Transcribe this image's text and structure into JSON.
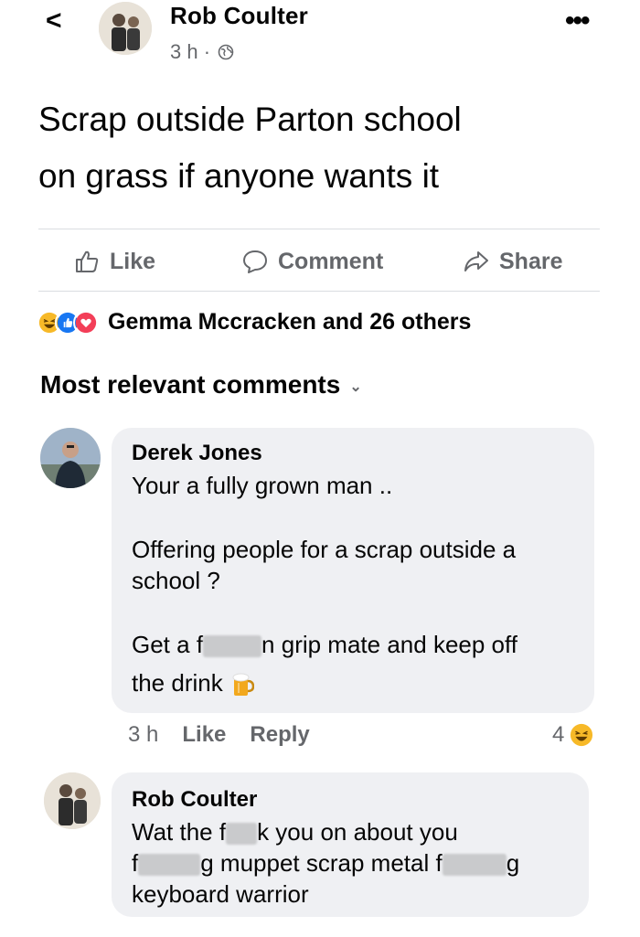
{
  "post": {
    "author": "Rob Coulter",
    "time": "3 h ·",
    "text_line1": "Scrap outside Parton school",
    "text_line2": "on grass if anyone wants it"
  },
  "actions": {
    "like": "Like",
    "comment": "Comment",
    "share": "Share"
  },
  "reactions": {
    "summary": "Gemma Mccracken and 26 others"
  },
  "comments_header": "Most relevant comments",
  "comments": [
    {
      "author": "Derek Jones",
      "line1": "Your a fully grown man ..",
      "line2": "Offering people for a scrap outside a",
      "line3": "school ?",
      "line4a": "Get a f",
      "line4b": "n grip mate and keep off",
      "line5": "the drink",
      "time": "3 h",
      "like": "Like",
      "reply": "Reply",
      "reaction_count": "4"
    },
    {
      "author": "Rob Coulter",
      "line1a": "Wat the f",
      "line1b": "k you on about you",
      "line2a": "f",
      "line2b": "g muppet scrap metal f",
      "line2c": "g",
      "line3": "keyboard warrior"
    }
  ],
  "icons": {
    "back": "chevron-left-icon",
    "more": "more-dots-icon",
    "privacy": "globe-icon",
    "like": "thumbs-up-icon",
    "comment": "comment-bubble-icon",
    "share": "share-arrow-icon",
    "beer": "beer-emoji"
  },
  "colors": {
    "secondary_text": "#65676b",
    "bubble": "#eff0f3",
    "like_blue": "#1877f2",
    "love_red": "#f33e58",
    "haha_yellow": "#f7b928"
  }
}
